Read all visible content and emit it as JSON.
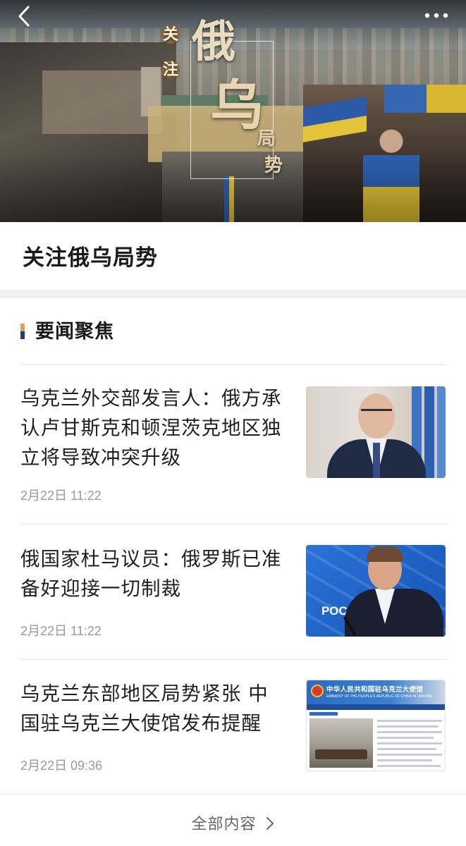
{
  "banner": {
    "word_1": "关",
    "word_2": "注",
    "word_3": "俄",
    "word_4": "乌",
    "word_5": "局",
    "word_6": "势",
    "accent_blue": "#2c63b5",
    "accent_yellow": "#e8c63d"
  },
  "nav": {
    "back_icon": "chevron-left-icon",
    "more_icon": "more-dots-icon"
  },
  "page": {
    "title": "关注俄乌局势"
  },
  "section": {
    "title": "要闻聚焦",
    "marker_colors": [
      "#d9a25a",
      "#1e3b7a"
    ]
  },
  "news": [
    {
      "headline": "乌克兰外交部发言人：俄方承认卢甘斯克和顿涅茨克地区独立将导致冲突升级",
      "headline_lines": [
        "乌克兰外交部发言人：俄方承",
        "认卢甘斯克和顿涅茨克地区独",
        "立将导致冲突升级"
      ],
      "time": "2月22日 11:22"
    },
    {
      "headline": "俄国家杜马议员：俄罗斯已准备好迎接一切制裁",
      "headline_lines": [
        "俄国家杜马议员：俄罗斯已准",
        "备好迎接一切制裁"
      ],
      "time": "2月22日 11:22",
      "thumb_logo": "РОСС"
    },
    {
      "headline": "乌克兰东部地区局势紧张 中国驻乌克兰大使馆发布提醒",
      "headline_lines": [
        "乌克兰东部地区局势紧张 中",
        "国驻乌克兰大使馆发布提醒"
      ],
      "time": "2月22日 09:36",
      "thumb_header": "中华人民共和国驻乌克兰大使馆",
      "thumb_subheader": "EMBASSY OF THE PEOPLE'S REPUBLIC OF CHINA IN UKRAINE"
    }
  ],
  "footer": {
    "more_label": "全部内容",
    "more_icon": "chevron-right-icon"
  }
}
